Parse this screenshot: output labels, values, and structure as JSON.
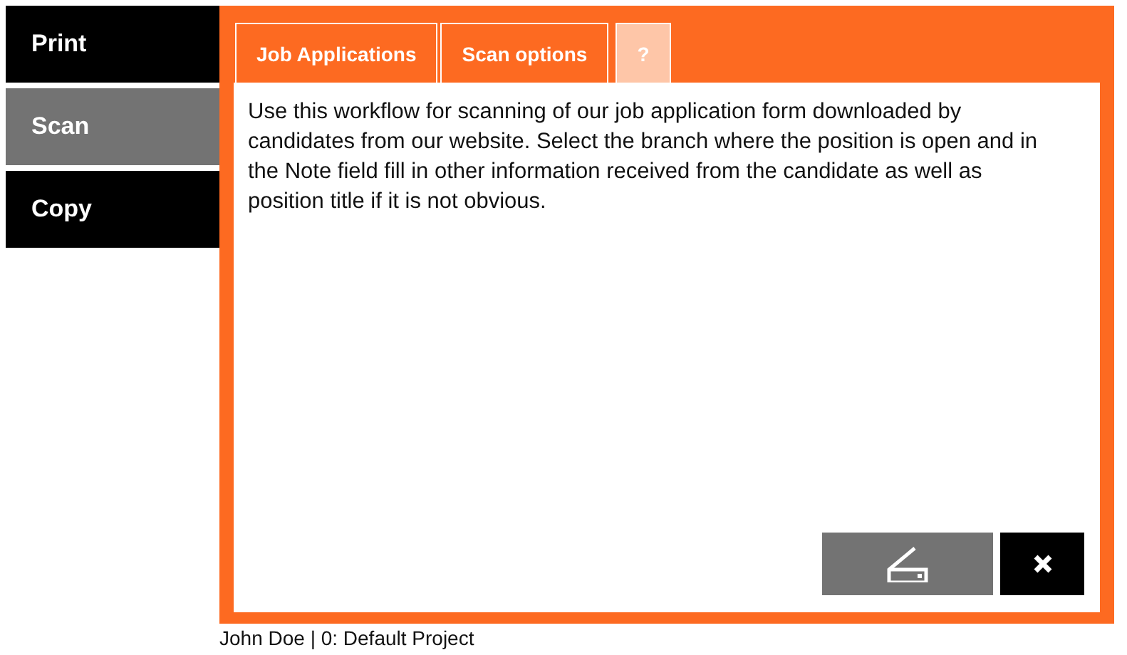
{
  "sidebar": {
    "items": [
      {
        "label": "Print",
        "selected": false
      },
      {
        "label": "Scan",
        "selected": true
      },
      {
        "label": "Copy",
        "selected": false
      }
    ]
  },
  "tabs": [
    {
      "label": "Job Applications",
      "disabled": false
    },
    {
      "label": "Scan options",
      "disabled": false
    },
    {
      "label": "?",
      "disabled": true
    }
  ],
  "description": "Use this workflow for scanning of our job application form downloaded by candidates from our website. Select the branch where the position is open and in the Note field fill in other information received from the candidate as well as position title if it is not obvious.",
  "status_bar": "John Doe | 0: Default Project"
}
